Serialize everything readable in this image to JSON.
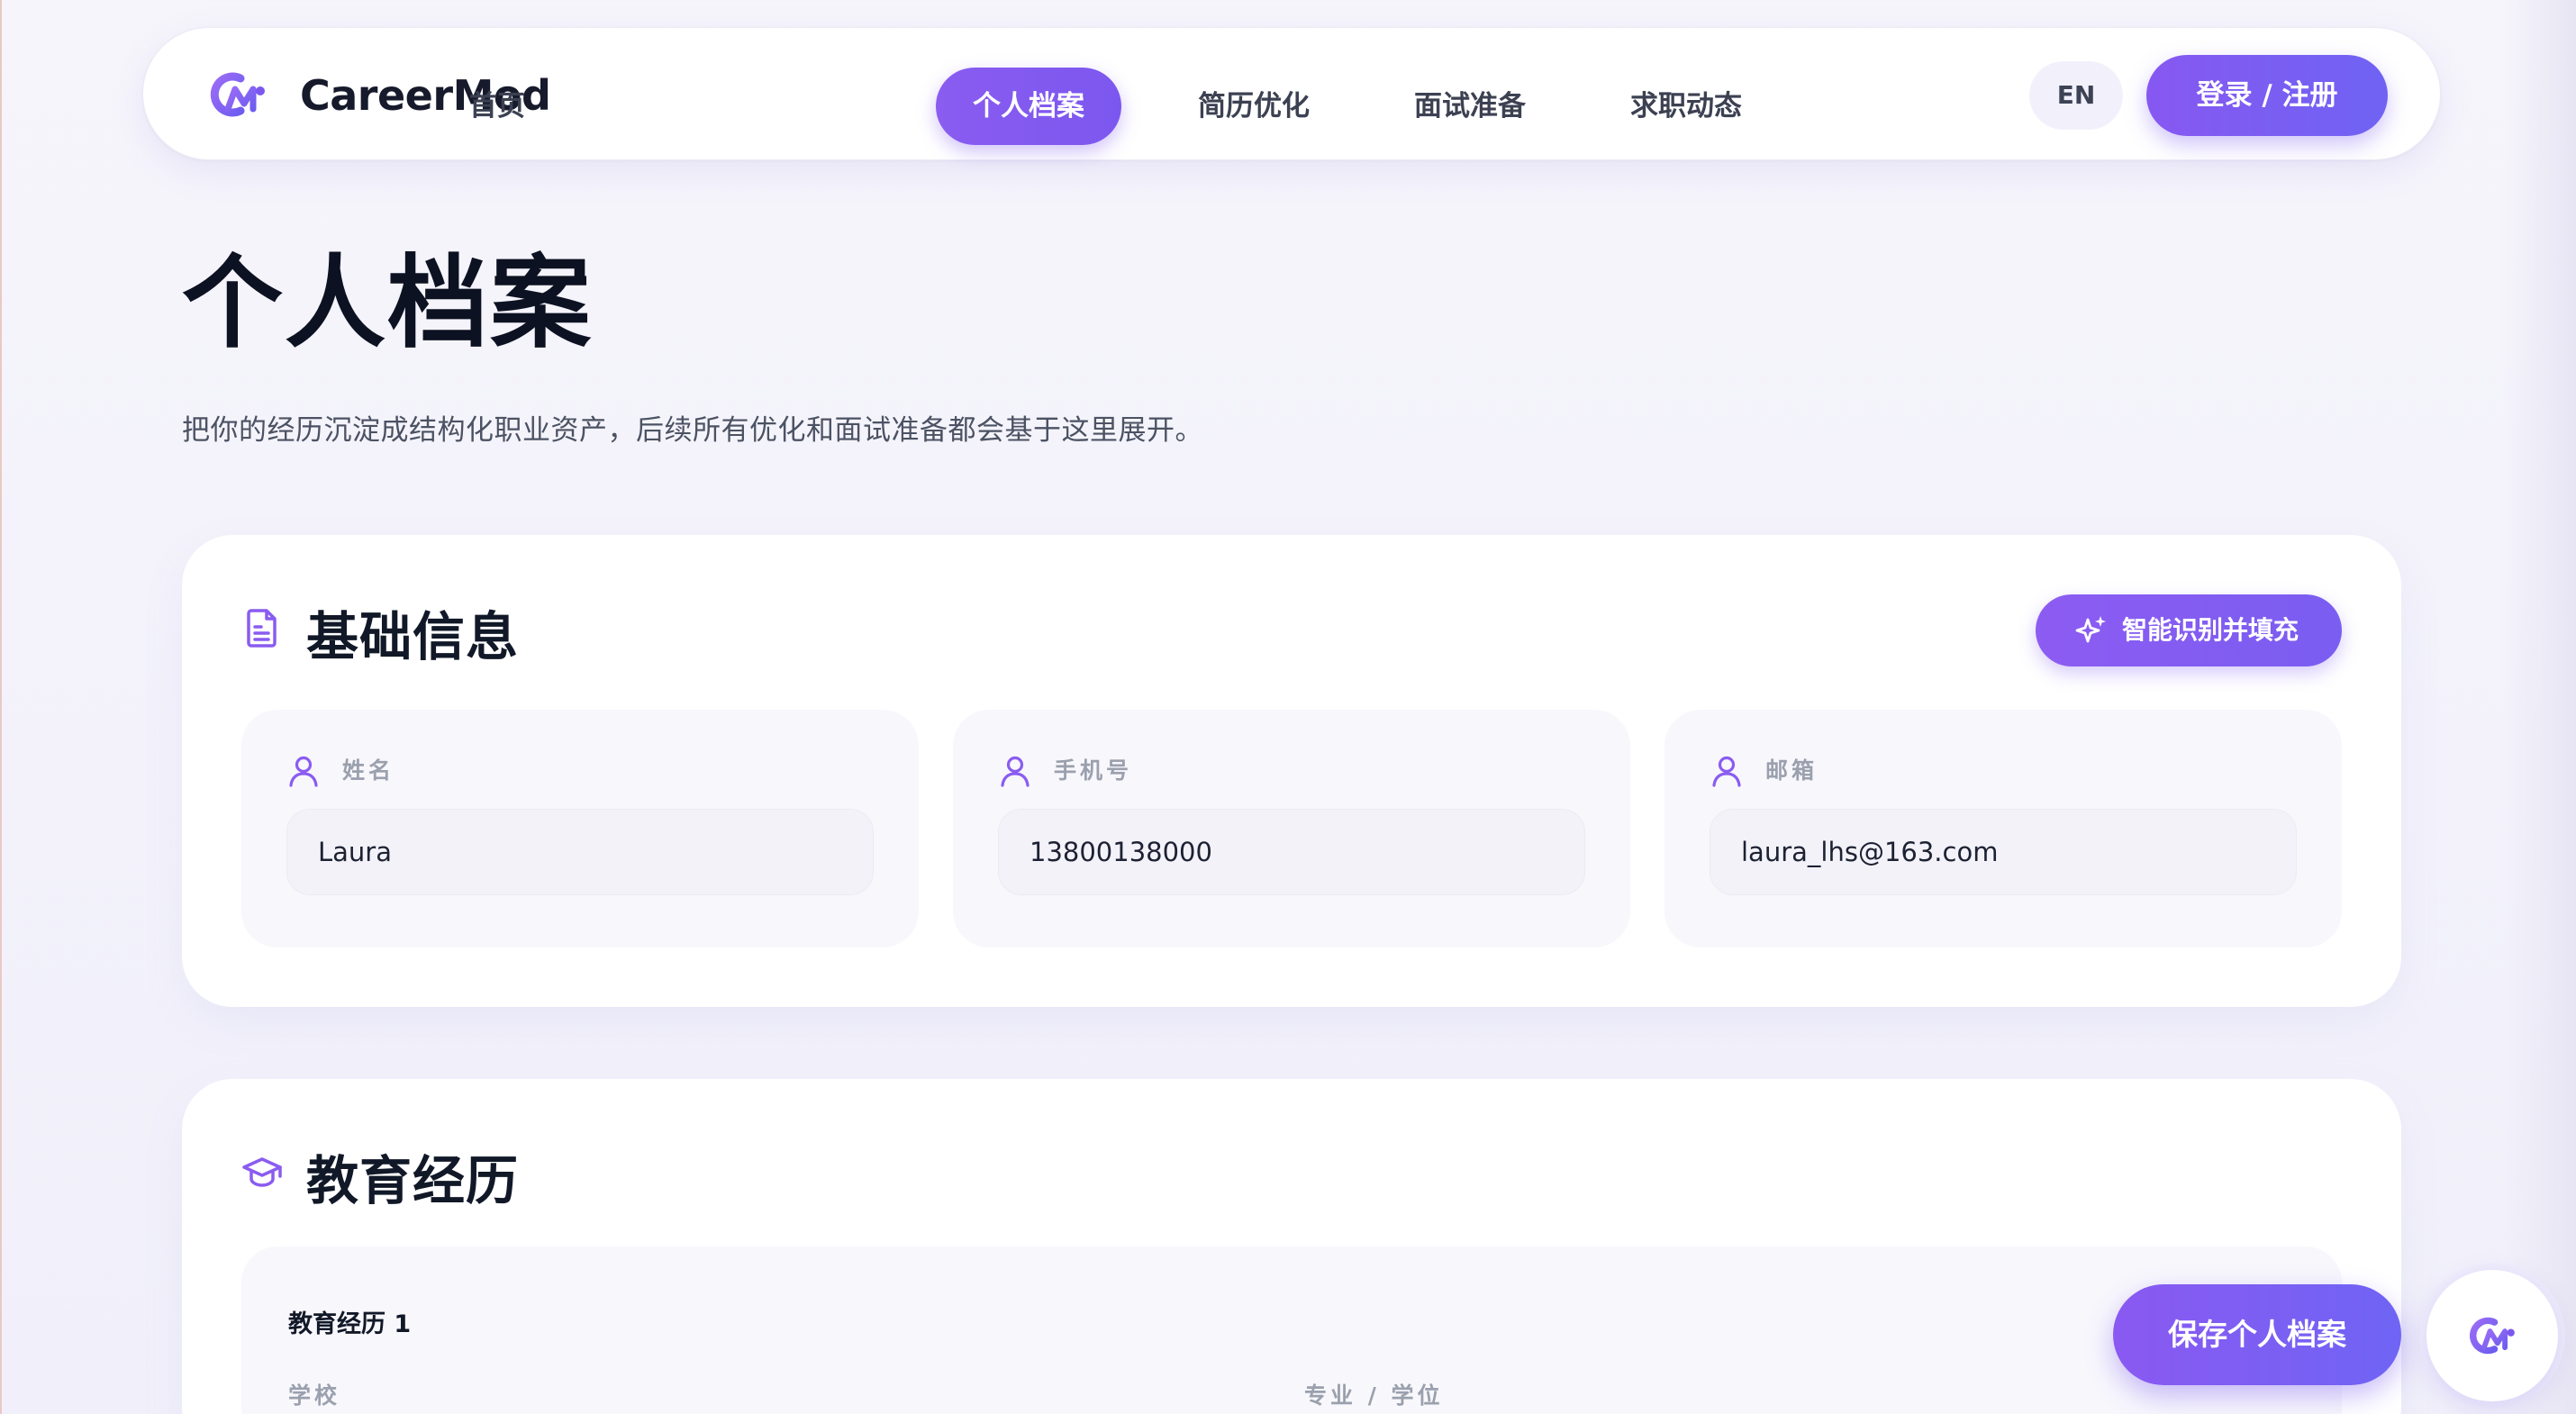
{
  "app": {
    "brand": "CareerMod",
    "accent_color": "#7c57ef",
    "logo_icon": "careermod-logo-icon"
  },
  "nav": {
    "items": [
      {
        "label": "首页",
        "active": false
      },
      {
        "label": "个人档案",
        "active": true
      },
      {
        "label": "简历优化",
        "active": false
      },
      {
        "label": "面试准备",
        "active": false
      },
      {
        "label": "求职动态",
        "active": false
      }
    ],
    "lang_label": "EN",
    "login_label": "登录 / 注册"
  },
  "page": {
    "title": "个人档案",
    "subtitle": "把你的经历沉淀成结构化职业资产，后续所有优化和面试准备都会基于这里展开。"
  },
  "basic_info": {
    "title": "基础信息",
    "icon": "document-icon",
    "ai_button_label": "智能识别并填充",
    "ai_button_icon": "sparkle-icon",
    "fields": [
      {
        "label": "姓名",
        "icon": "user-icon",
        "value": "Laura"
      },
      {
        "label": "手机号",
        "icon": "user-icon",
        "value": "13800138000"
      },
      {
        "label": "邮箱",
        "icon": "user-icon",
        "value": "laura_lhs@163.com"
      }
    ]
  },
  "education": {
    "title": "教育经历",
    "icon": "graduation-cap-icon",
    "items": [
      {
        "title": "教育经历 1",
        "school_label": "学校",
        "major_label": "专业 / 学位"
      }
    ]
  },
  "actions": {
    "save_label": "保存个人档案",
    "assistant_icon": "assistant-logo-icon"
  }
}
